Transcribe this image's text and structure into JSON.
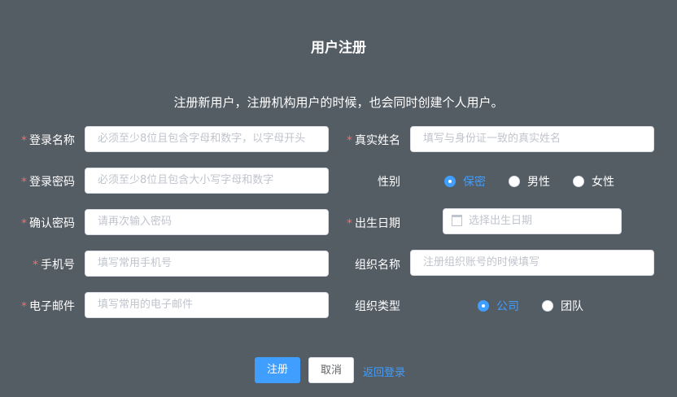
{
  "page": {
    "title": "用户注册",
    "subtitle": "注册新用户，注册机构用户的时候，也会同时创建个人用户。"
  },
  "form": {
    "username": {
      "label": "登录名称",
      "placeholder": "必须至少8位且包含字母和数字，以字母开头",
      "required": true
    },
    "realname": {
      "label": "真实姓名",
      "placeholder": "填写与身份证一致的真实姓名",
      "required": true
    },
    "password": {
      "label": "登录密码",
      "placeholder": "必须至少8位且包含大小写字母和数字",
      "required": true
    },
    "gender": {
      "label": "性别",
      "options": [
        "保密",
        "男性",
        "女性"
      ],
      "selected": "保密"
    },
    "confirm": {
      "label": "确认密码",
      "placeholder": "请再次输入密码",
      "required": true
    },
    "birthday": {
      "label": "出生日期",
      "placeholder": "选择出生日期",
      "required": true
    },
    "phone": {
      "label": "手机号",
      "placeholder": "填写常用手机号",
      "required": true
    },
    "orgname": {
      "label": "组织名称",
      "placeholder": "注册组织账号的时候填写"
    },
    "email": {
      "label": "电子邮件",
      "placeholder": "填写常用的电子邮件",
      "required": true
    },
    "orgtype": {
      "label": "组织类型",
      "options": [
        "公司",
        "团队"
      ],
      "selected": "公司"
    },
    "required_mark": "*"
  },
  "actions": {
    "submit": "注册",
    "cancel": "取消",
    "back": "返回登录"
  },
  "colors": {
    "accent": "#409eff",
    "background": "#545c64",
    "required": "#f56c6c"
  }
}
